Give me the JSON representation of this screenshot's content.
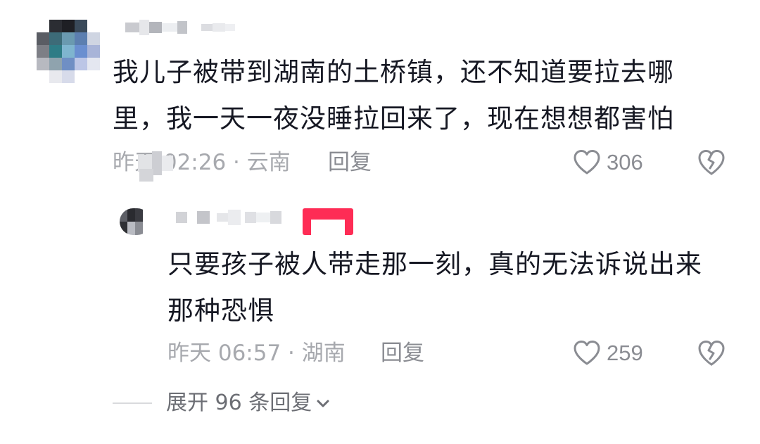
{
  "comments": [
    {
      "text_line1": "我儿子被带到湖南的土桥镇，还不知道要拉去哪",
      "text_line2": "里，我一天一夜没睡拉回来了，现在想想都害怕",
      "meta": "昨天 02:26 · 云南",
      "reply_label": "回复",
      "likes": "306",
      "avatar_icon": "user-avatar-mosaic",
      "like_icon": "heart-outline-icon",
      "dislike_icon": "broken-heart-icon"
    }
  ],
  "reply": {
    "text_line1": "只要孩子被人带走那一刻，真的无法诉说出来",
    "text_line2": "那种恐惧",
    "meta": "昨天 06:57 · 湖南",
    "reply_label": "回复",
    "likes": "259",
    "author_badge_color": "#fe2c55"
  },
  "expand": {
    "label": "展开 96 条回复",
    "icon": "chevron-down-icon"
  },
  "colors": {
    "text_primary": "#161823",
    "text_secondary": "#a7a9ae",
    "accent": "#fe2c55"
  }
}
